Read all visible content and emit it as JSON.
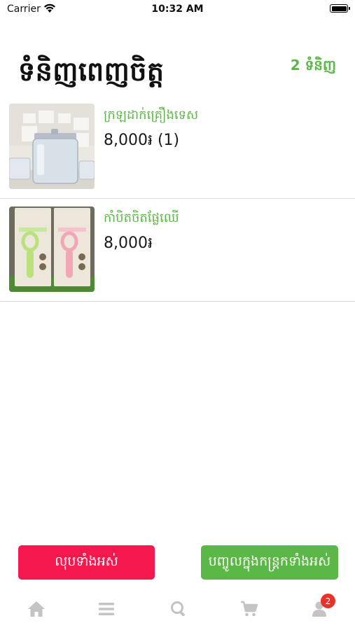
{
  "status_bar": {
    "carrier": "Carrier",
    "time": "10:32 AM"
  },
  "header": {
    "title": "ទំនិញពេញចិត្ត",
    "count": "2 ទំនិញ"
  },
  "products": [
    {
      "name": "ក្រឡដាក់គ្រឿងទេស",
      "price": "8,000៛ (1)"
    },
    {
      "name": "កាំបិតចិតផ្លែឈើ",
      "price": "8,000៛"
    }
  ],
  "actions": {
    "remove_all": "លុបទាំងអស់",
    "add_all_to_cart": "បញ្ចូលក្នុងកន្ត្រកទាំងអស់"
  },
  "tab_bar": {
    "icons": [
      "home-icon",
      "menu-icon",
      "search-icon",
      "cart-icon",
      "profile-icon"
    ],
    "profile_badge": "2"
  },
  "colors": {
    "accent_green": "#5cb846",
    "danger_red": "#f5184e",
    "badge_red": "#e8332b",
    "inactive_icon": "#c4c4c4"
  }
}
